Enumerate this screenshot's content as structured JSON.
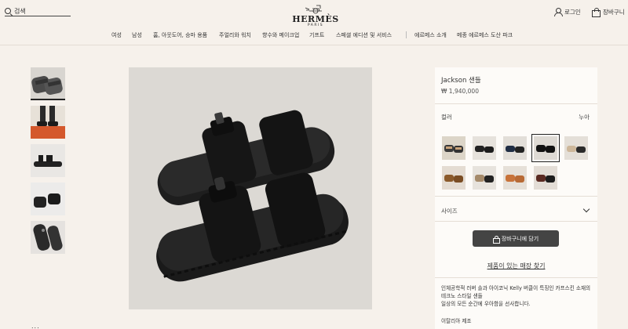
{
  "header": {
    "search_placeholder": "검색",
    "logo_name": "HERMÈS",
    "logo_city": "PARIS",
    "login_label": "로그인",
    "cart_label": "장바구니"
  },
  "nav": {
    "items": [
      "여성",
      "남성",
      "홈, 아웃도어, 승마 용품",
      "주얼리와 워치",
      "향수와 메이크업",
      "기프트",
      "스페셜 에디션 및 서비스",
      "에르메스 소개",
      "메종 에르메스 도산 파크"
    ]
  },
  "product": {
    "name": "Jackson 샌들",
    "price": "₩ 1,940,000",
    "color_label": "컬러",
    "color_value": "누아",
    "size_label": "사이즈",
    "add_to_cart": "장바구니에 담기",
    "store_link": "제품이 있는 매장 찾기",
    "description": "인체공학적 러버 솔과 아이코닉 Kelly 버클이 특징인 카프스킨 소재의 테크노 스타일 샌들\n일상의 모든 순간에 우아함을 선사합니다.",
    "origin": "이탈리아 제조"
  },
  "bottom_peek_text": "...",
  "colors": {
    "background": "#f6f1eb",
    "panel": "#fdfbf8",
    "button": "#444444"
  },
  "icons": [
    "search-icon",
    "user-icon",
    "shopping-bag-icon",
    "chevron-down-icon"
  ]
}
